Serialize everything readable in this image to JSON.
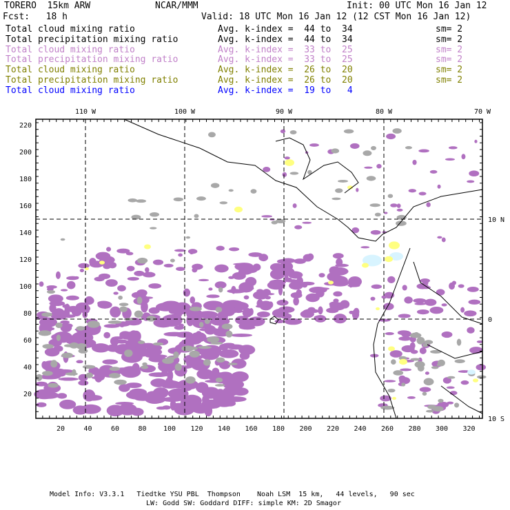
{
  "header": {
    "title": "TORERO  15km ARW",
    "org": "NCAR/MMM",
    "init": "Init: 00 UTC Mon 16 Jan 12",
    "fcst": "Fcst:   18 h",
    "valid": "Valid: 18 UTC Mon 16 Jan 12 (12 CST Mon 16 Jan 12)"
  },
  "legend": [
    {
      "field": "Total cloud mixing ratio",
      "range": "Avg. k-index =  44 to  34",
      "sm": "sm= 2",
      "color": "#000000"
    },
    {
      "field": "Total precipitation mixing ratio",
      "range": "Avg. k-index =  44 to  34",
      "sm": "sm= 2",
      "color": "#000000"
    },
    {
      "field": "Total cloud mixing ratio",
      "range": "Avg. k-index =  33 to  25",
      "sm": "sm= 2",
      "color": "#c080c8"
    },
    {
      "field": "Total precipitation mixing ratio",
      "range": "Avg. k-index =  33 to  25",
      "sm": "sm= 2",
      "color": "#c080c8"
    },
    {
      "field": "Total cloud mixing ratio",
      "range": "Avg. k-index =  26 to  20",
      "sm": "sm= 2",
      "color": "#808000"
    },
    {
      "field": "Total precipitation mixing ratio",
      "range": "Avg. k-index =  26 to  20",
      "sm": "sm= 2",
      "color": "#808000"
    },
    {
      "field": "Total cloud mixing ratio",
      "range": "Avg. k-index =  19 to   4",
      "sm": "",
      "color": "#0000ff"
    }
  ],
  "map": {
    "lon_labels": [
      "110 W",
      "100 W",
      "90 W",
      "80 W",
      "70 W"
    ],
    "lat_labels": [
      "10 N",
      "0",
      "10 S"
    ],
    "y_ticks": [
      "220",
      "200",
      "180",
      "160",
      "140",
      "120",
      "100",
      "80",
      "60",
      "40",
      "20"
    ],
    "x_ticks": [
      "20",
      "40",
      "60",
      "80",
      "100",
      "120",
      "140",
      "160",
      "180",
      "200",
      "220",
      "240",
      "260",
      "280",
      "300",
      "320"
    ],
    "colors": {
      "purple": "#b070c0",
      "grey": "#a8a8a8",
      "yellow": "#ffff80",
      "cyan": "#d8f4ff"
    }
  },
  "footer": {
    "line1": "Model Info: V3.3.1   Tiedtke YSU PBL  Thompson    Noah LSM  15 km,   44 levels,   90 sec",
    "line2": "LW: Godd SW: Goddard DIFF: simple KM: 2D Smagor"
  }
}
